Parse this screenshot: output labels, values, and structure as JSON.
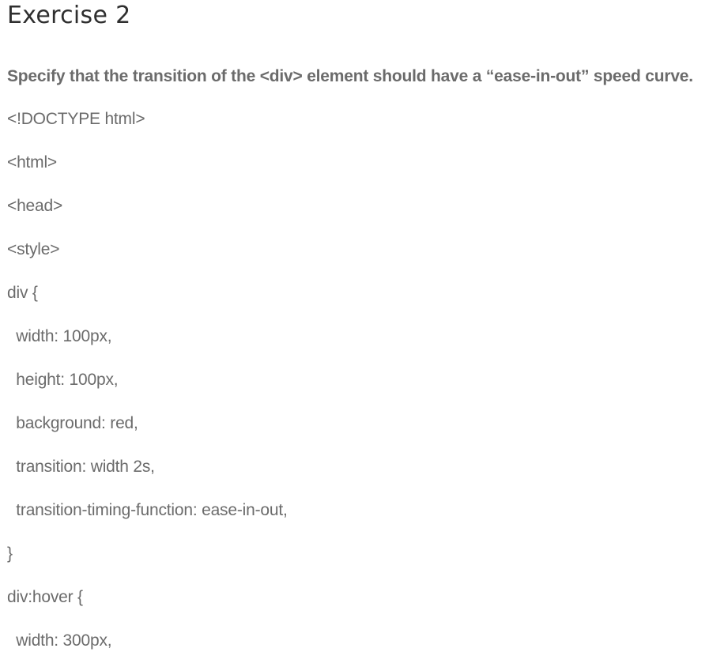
{
  "heading": "Exercise 2",
  "instruction": "Specify that the transition of the <div> element should have a “ease-in-out” speed curve.",
  "code_lines": [
    "<!DOCTYPE html>",
    "<html>",
    "<head>",
    "<style>",
    "div {",
    "  width: 100px,",
    "  height: 100px,",
    "  background: red,",
    "  transition: width 2s,",
    "  transition-timing-function: ease-in-out,",
    "}",
    "div:hover {",
    "  width: 300px,"
  ]
}
